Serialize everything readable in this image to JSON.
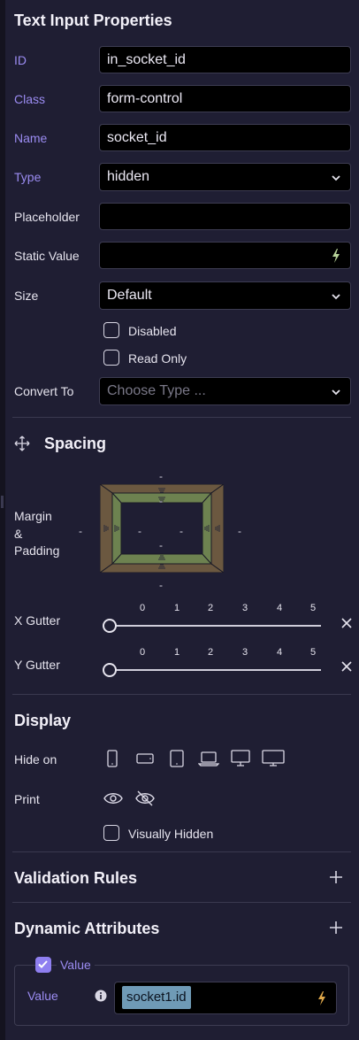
{
  "title": "Text Input Properties",
  "fields": {
    "id": {
      "label": "ID",
      "value": "in_socket_id"
    },
    "class": {
      "label": "Class",
      "value": "form-control"
    },
    "name": {
      "label": "Name",
      "value": "socket_id"
    },
    "type": {
      "label": "Type",
      "value": "hidden"
    },
    "placeholder": {
      "label": "Placeholder",
      "value": ""
    },
    "static_value": {
      "label": "Static Value",
      "value": ""
    },
    "size": {
      "label": "Size",
      "value": "Default"
    },
    "disabled": {
      "label": "Disabled",
      "checked": false
    },
    "read_only": {
      "label": "Read Only",
      "checked": false
    },
    "convert_to": {
      "label": "Convert To",
      "placeholder": "Choose Type ..."
    }
  },
  "spacing": {
    "heading": "Spacing",
    "label_line1": "Margin",
    "label_line2": "&",
    "label_line3": "Padding",
    "dash": "-",
    "x_gutter": {
      "label": "X Gutter",
      "ticks": [
        "0",
        "1",
        "2",
        "3",
        "4",
        "5"
      ],
      "value": 0
    },
    "y_gutter": {
      "label": "Y Gutter",
      "ticks": [
        "0",
        "1",
        "2",
        "3",
        "4",
        "5"
      ],
      "value": 0
    },
    "colors": {
      "margin": "#6b5840",
      "padding": "#6d8250"
    }
  },
  "display": {
    "heading": "Display",
    "hide_on_label": "Hide on",
    "hide_on_devices": [
      "phone-icon",
      "phone-landscape-icon",
      "tablet-icon",
      "laptop-icon",
      "desktop-icon",
      "large-desktop-icon"
    ],
    "print_label": "Print",
    "print_options": [
      "eye-icon",
      "eye-off-icon"
    ],
    "visually_hidden": {
      "label": "Visually Hidden",
      "checked": false
    }
  },
  "validation": {
    "heading": "Validation Rules"
  },
  "dynamic": {
    "heading": "Dynamic Attributes",
    "value_toggle": {
      "label": "Value",
      "checked": true
    },
    "value_label": "Value",
    "value_chip": "socket1.id"
  },
  "colors": {
    "accent": "#9b8cf2",
    "bolt_active": "#e0a84a",
    "bolt_idle": "#b8d49a"
  }
}
